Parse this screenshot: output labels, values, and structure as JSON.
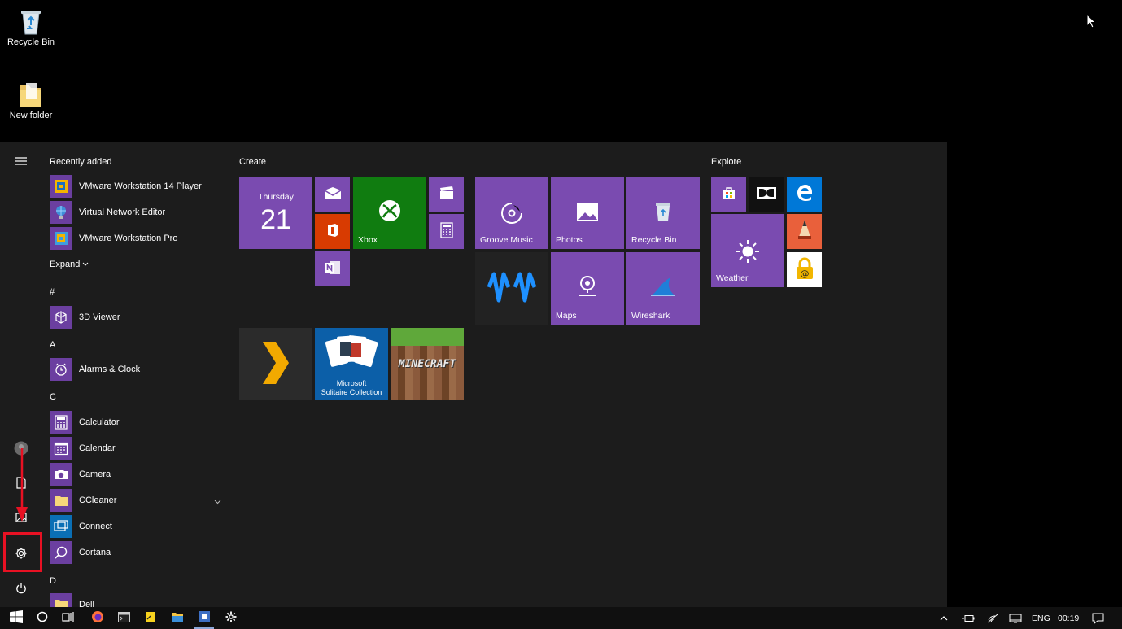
{
  "desktop": {
    "icons": [
      {
        "label": "Recycle Bin"
      },
      {
        "label": "New folder"
      }
    ]
  },
  "start_menu": {
    "recently_added_header": "Recently added",
    "recent_apps": [
      {
        "label": "VMware Workstation 14 Player",
        "icon": "vmware-player-icon"
      },
      {
        "label": "Virtual Network Editor",
        "icon": "globe-network-icon"
      },
      {
        "label": "VMware Workstation Pro",
        "icon": "vmware-pro-icon"
      }
    ],
    "expand_label": "Expand",
    "sections": [
      {
        "letter": "#",
        "apps": [
          {
            "label": "3D Viewer",
            "icon": "cube-icon"
          }
        ]
      },
      {
        "letter": "A",
        "apps": [
          {
            "label": "Alarms & Clock",
            "icon": "alarm-clock-icon"
          }
        ]
      },
      {
        "letter": "C",
        "apps": [
          {
            "label": "Calculator",
            "icon": "calculator-icon"
          },
          {
            "label": "Calendar",
            "icon": "calendar-icon"
          },
          {
            "label": "Camera",
            "icon": "camera-icon"
          },
          {
            "label": "CCleaner",
            "icon": "folder-icon"
          },
          {
            "label": "Connect",
            "icon": "connect-icon"
          },
          {
            "label": "Cortana",
            "icon": "search-circle-icon"
          }
        ]
      },
      {
        "letter": "D",
        "apps": [
          {
            "label": "Dell",
            "icon": "folder-icon"
          }
        ]
      }
    ],
    "groups": {
      "create": "Create",
      "explore": "Explore"
    },
    "tiles": {
      "calendar_day": "Thursday",
      "calendar_date": "21",
      "xbox": "Xbox",
      "groove": "Groove Music",
      "photos": "Photos",
      "recycle_bin": "Recycle Bin",
      "maps": "Maps",
      "wireshark": "Wireshark",
      "weather": "Weather",
      "solitaire_line1": "Microsoft",
      "solitaire_line2": "Solitaire Collection",
      "minecraft": "MINECRAFT"
    }
  },
  "taskbar": {
    "language": "ENG",
    "time": "00:19"
  },
  "colors": {
    "tile_purple": "#7a4bb0",
    "xbox_green": "#107c10",
    "office_orange": "#d83b01",
    "edge_blue": "#0078d7",
    "highlight_red": "#e81123"
  }
}
